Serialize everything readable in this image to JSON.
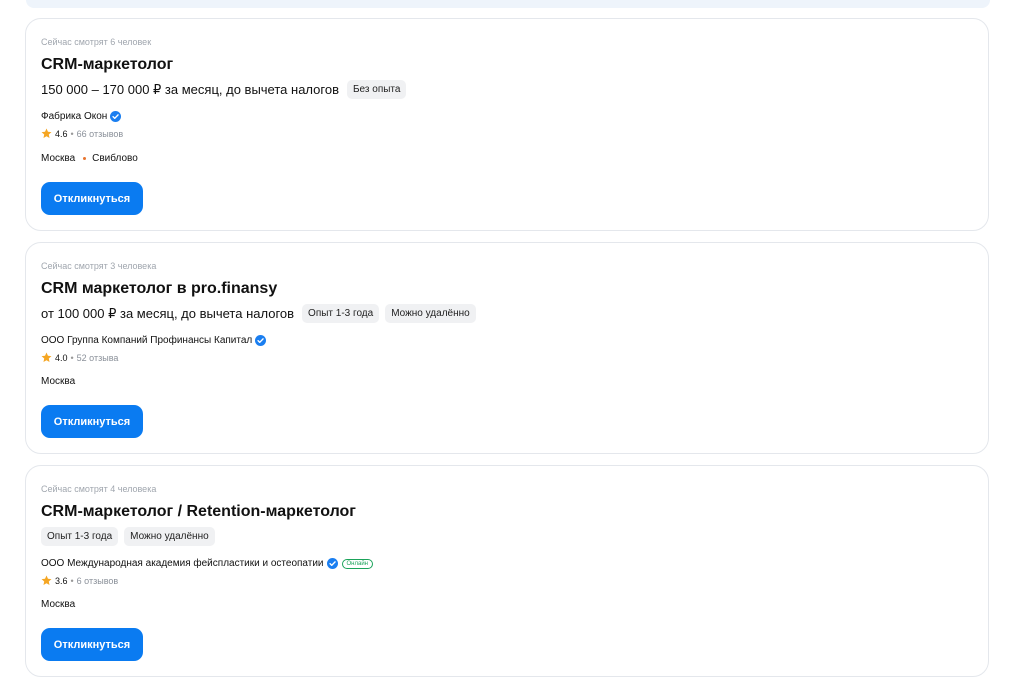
{
  "apply_label": "Откликнуться",
  "colors": {
    "accent": "#0a7bf1",
    "star": "#f5a623",
    "verified": "#1a7ef0",
    "online": "#1ba35a",
    "metro": "#e8742f"
  },
  "vacancies": [
    {
      "viewers": "Сейчас смотрят 6 человек",
      "title": "CRM-маркетолог",
      "salary": "150 000 – 170 000 ₽ за месяц, до вычета налогов",
      "tags": [
        "Без опыта"
      ],
      "company": "Фабрика Окон",
      "rating": "4.6",
      "reviews": "66 отзывов",
      "city": "Москва",
      "metro": "Свиблово"
    },
    {
      "viewers": "Сейчас смотрят 3 человека",
      "title": "CRM маркетолог в pro.finansy",
      "salary": "от 100 000 ₽ за месяц, до вычета налогов",
      "tags": [
        "Опыт 1-3 года",
        "Можно удалённо"
      ],
      "company": "ООО Группа Компаний Профинансы Капитал",
      "rating": "4.0",
      "reviews": "52 отзыва",
      "city": "Москва"
    },
    {
      "viewers": "Сейчас смотрят 4 человека",
      "title": "CRM-маркетолог / Retention-маркетолог",
      "tags": [
        "Опыт 1-3 года",
        "Можно удалённо"
      ],
      "company": "ООО Международная академия фейспластики и остеопатии",
      "online_badge": "Онлайн",
      "rating": "3.6",
      "reviews": "6 отзывов",
      "city": "Москва"
    }
  ]
}
